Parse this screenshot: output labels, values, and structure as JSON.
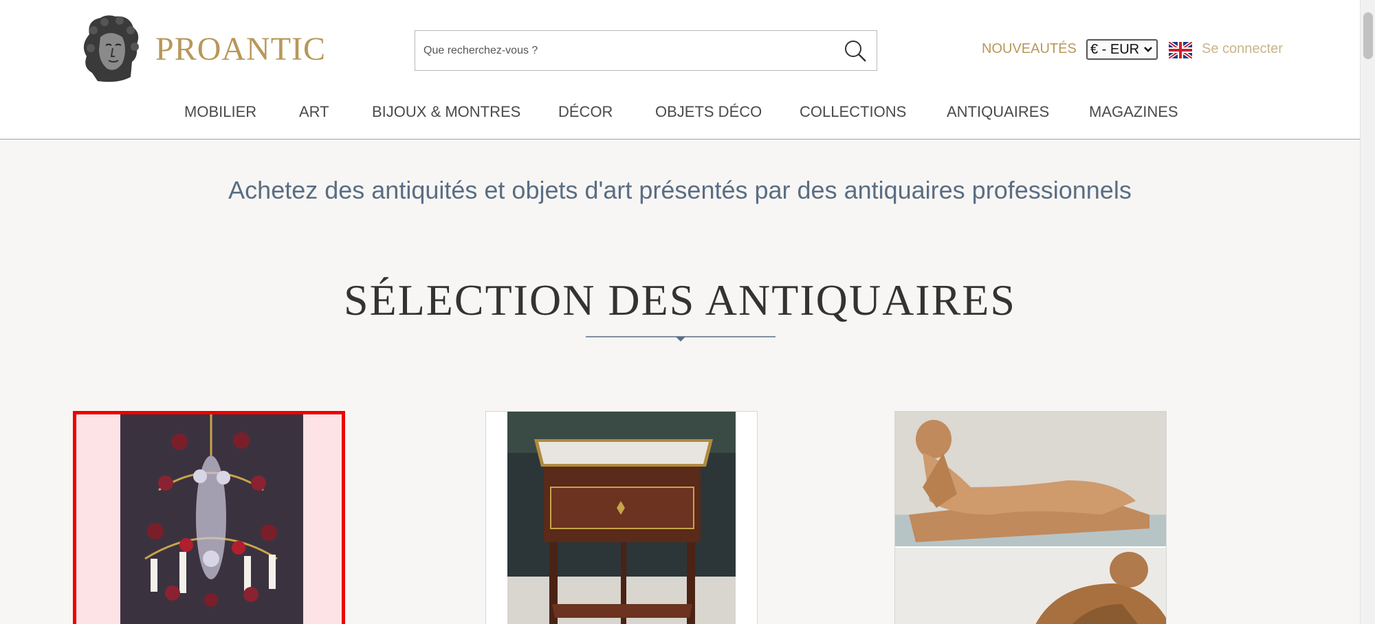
{
  "header": {
    "logo_text": "PROANTIC",
    "search_placeholder": "Que recherchez-vous ?",
    "nouveautes": "NOUVEAUTÉS",
    "currency": "€ - EUR",
    "login": "Se connecter"
  },
  "nav": {
    "items": [
      {
        "label": "MOBILIER"
      },
      {
        "label": "ART"
      },
      {
        "label": "BIJOUX & MONTRES"
      },
      {
        "label": "DÉCOR"
      },
      {
        "label": "OBJETS DÉCO"
      },
      {
        "label": "COLLECTIONS"
      },
      {
        "label": "ANTIQUAIRES"
      },
      {
        "label": "MAGAZINES"
      }
    ]
  },
  "main": {
    "tagline": "Achetez des antiquités et objets d'art présentés par des antiquaires professionnels",
    "section_title": "SÉLECTION DES ANTIQUAIRES"
  },
  "colors": {
    "gold": "#b8975a",
    "nav_text": "#4a4a4a",
    "tagline": "#5a6d84",
    "highlight_border": "#ee0000"
  },
  "icons": [
    "bust-logo-icon",
    "search-icon",
    "uk-flag-icon",
    "chevron-down-icon"
  ]
}
